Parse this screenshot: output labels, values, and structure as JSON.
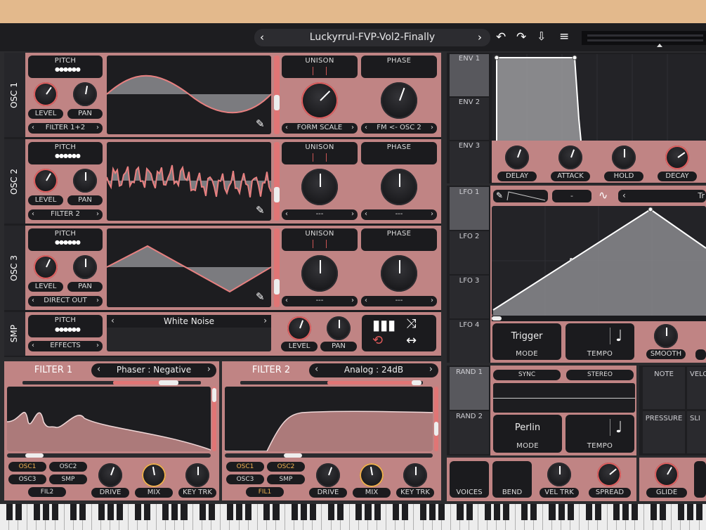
{
  "header": {
    "preset_name": "Luckyrrul-FVP-Vol2-Finally",
    "prev_icon": "chevron-left-icon",
    "next_icon": "chevron-right-icon"
  },
  "osc": [
    {
      "label": "OSC 1",
      "pitch": "PITCH",
      "level": "LEVEL",
      "pan": "PAN",
      "route": "FILTER 1+2",
      "unison": "UNISON",
      "phase": "PHASE",
      "mod1": "FORM SCALE",
      "mod2": "FM <- OSC 2"
    },
    {
      "label": "OSC 2",
      "pitch": "PITCH",
      "level": "LEVEL",
      "pan": "PAN",
      "route": "FILTER 2",
      "unison": "UNISON",
      "phase": "PHASE",
      "mod1": "---",
      "mod2": "---"
    },
    {
      "label": "OSC 3",
      "pitch": "PITCH",
      "level": "LEVEL",
      "pan": "PAN",
      "route": "DIRECT OUT",
      "unison": "UNISON",
      "phase": "PHASE",
      "mod1": "---",
      "mod2": "---"
    }
  ],
  "smp": {
    "label": "SMP",
    "pitch": "PITCH",
    "route": "EFFECTS",
    "sample": "White Noise",
    "level": "LEVEL",
    "pan": "PAN"
  },
  "filter1": {
    "title": "FILTER 1",
    "type": "Phaser : Negative",
    "osc1": "OSC1",
    "osc2": "OSC2",
    "osc3": "OSC3",
    "smp": "SMP",
    "fil": "FIL2",
    "drive": "DRIVE",
    "mix": "MIX",
    "keytrk": "KEY TRK"
  },
  "filter2": {
    "title": "FILTER 2",
    "type": "Analog : 24dB",
    "osc1": "OSC1",
    "osc2": "OSC2",
    "osc3": "OSC3",
    "smp": "SMP",
    "fil": "FIL1",
    "drive": "DRIVE",
    "mix": "MIX",
    "keytrk": "KEY TRK"
  },
  "env": {
    "tabs": [
      "ENV 1",
      "ENV 2",
      "ENV 3"
    ],
    "knobs": [
      "DELAY",
      "ATTACK",
      "HOLD",
      "DECAY"
    ]
  },
  "lfo": {
    "tabs": [
      "LFO 1",
      "LFO 2",
      "LFO 3",
      "LFO 4"
    ],
    "dash": "-",
    "shape": "Tr",
    "mode_value": "Trigger",
    "mode": "MODE",
    "tempo": "TEMPO",
    "smooth": "SMOOTH"
  },
  "rand": {
    "tabs": [
      "RAND 1",
      "RAND 2"
    ],
    "sync": "SYNC",
    "stereo": "STEREO",
    "mode_value": "Perlin",
    "mode": "MODE",
    "tempo": "TEMPO"
  },
  "mpe": {
    "note": "NOTE",
    "velo": "VELO",
    "pressure": "PRESSURE",
    "slide": "SLI"
  },
  "voice": {
    "voices": "VOICES",
    "bend": "BEND",
    "veltrk": "VEL TRK",
    "spread": "SPREAD",
    "glide": "GLIDE"
  }
}
